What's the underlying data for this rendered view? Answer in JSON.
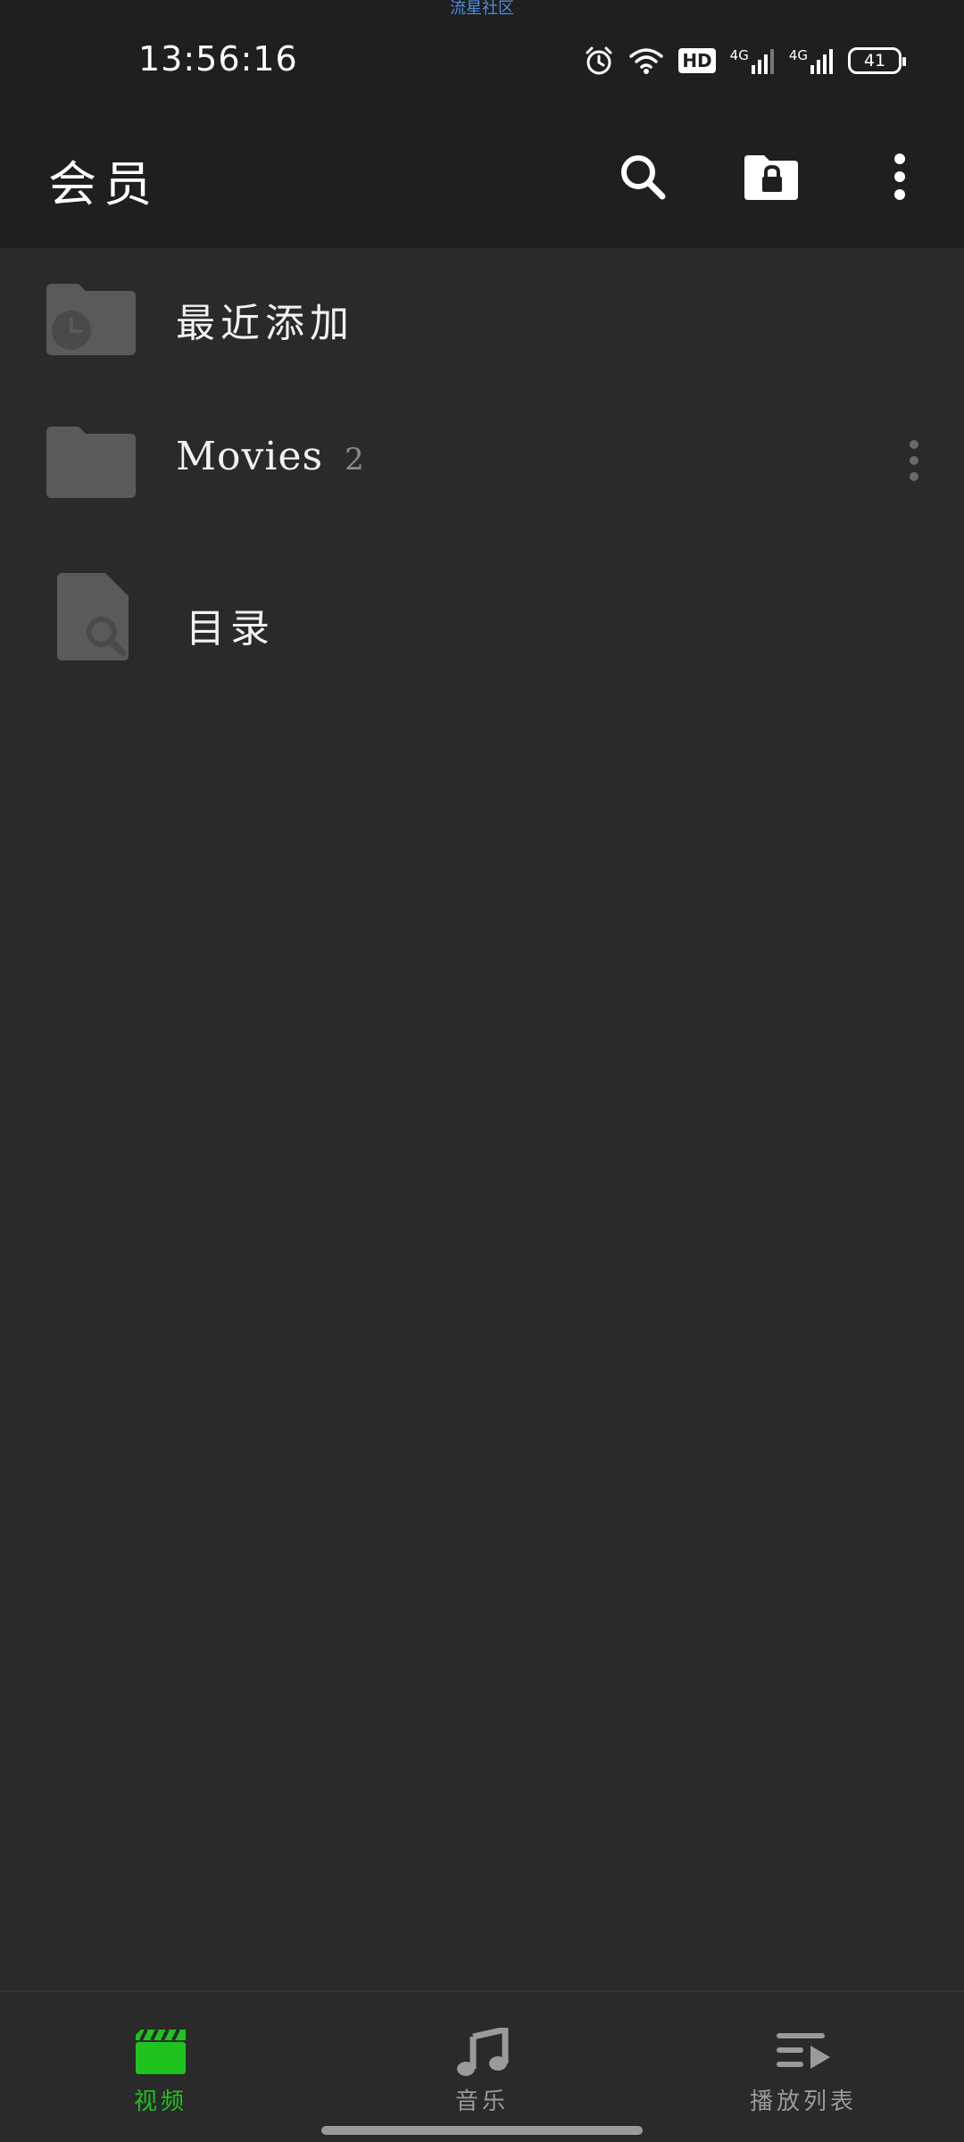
{
  "status_bar": {
    "watermark": "流星社区",
    "time": "13:56:16",
    "hd_label": "HD",
    "network_1": "4G",
    "network_2": "4G",
    "battery": "41"
  },
  "app_bar": {
    "title": "会员",
    "icons": [
      "search-icon",
      "folder-lock-icon",
      "more-vert-icon"
    ]
  },
  "list": {
    "items": [
      {
        "label": "最近添加",
        "icon": "folder-clock-icon"
      },
      {
        "label": "Movies",
        "count": "2",
        "icon": "folder-icon"
      },
      {
        "label": "目录",
        "icon": "file-search-icon"
      }
    ]
  },
  "bottom_nav": {
    "items": [
      {
        "label": "视频",
        "icon": "clapperboard-icon",
        "active": true
      },
      {
        "label": "音乐",
        "icon": "music-note-icon",
        "active": false
      },
      {
        "label": "播放列表",
        "icon": "playlist-play-icon",
        "active": false
      }
    ]
  },
  "colors": {
    "background": "#2a2a2a",
    "bar": "#1f1f1f",
    "accent_active": "#1ec31e",
    "inactive": "#9a9a9a",
    "icon_gray": "#5a5a5a"
  }
}
